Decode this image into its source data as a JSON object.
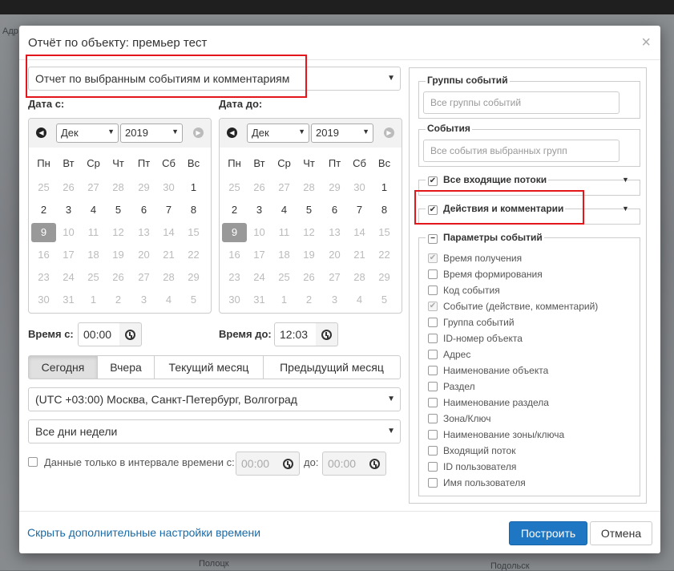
{
  "modal": {
    "title": "Отчёт по объекту: премьер  тест",
    "close": "×"
  },
  "report_type": {
    "selected": "Отчет по выбранным событиям и комментариям"
  },
  "date_from": {
    "label": "Дата с:",
    "month": "Дек",
    "year": "2019",
    "weekdays": [
      "Пн",
      "Вт",
      "Ср",
      "Чт",
      "Пт",
      "Сб",
      "Вс"
    ],
    "weeks": [
      [
        "25",
        "26",
        "27",
        "28",
        "29",
        "30",
        "1"
      ],
      [
        "2",
        "3",
        "4",
        "5",
        "6",
        "7",
        "8"
      ],
      [
        "9",
        "10",
        "11",
        "12",
        "13",
        "14",
        "15"
      ],
      [
        "16",
        "17",
        "18",
        "19",
        "20",
        "21",
        "22"
      ],
      [
        "23",
        "24",
        "25",
        "26",
        "27",
        "28",
        "29"
      ],
      [
        "30",
        "31",
        "1",
        "2",
        "3",
        "4",
        "5"
      ]
    ],
    "time_label": "Время с:",
    "time": "00:00"
  },
  "date_to": {
    "label": "Дата до:",
    "month": "Дек",
    "year": "2019",
    "time_label": "Время до:",
    "time": "12:03"
  },
  "quick": [
    "Сегодня",
    "Вчера",
    "Текущий месяц",
    "Предыдущий месяц"
  ],
  "timezone": "(UTC +03:00) Москва, Санкт-Петербург, Волгоград",
  "weekdays_select": "Все дни недели",
  "interval": {
    "label": "Данные только в интервале времени с:",
    "from_placeholder": "00:00",
    "to_label": "до:",
    "to_placeholder": "00:00"
  },
  "right": {
    "groups_title": "Группы событий",
    "groups_placeholder": "Все группы событий",
    "events_title": "События",
    "events_placeholder": "Все события выбранных групп",
    "streams_title": "Все входящие потоки",
    "actions_title": "Действия и комментарии",
    "params_title": "Параметры событий",
    "params": [
      {
        "label": "Время получения",
        "checked": true,
        "disabled": true
      },
      {
        "label": "Время формирования",
        "checked": false,
        "disabled": false
      },
      {
        "label": "Код события",
        "checked": false,
        "disabled": false
      },
      {
        "label": "Событие (действие, комментарий)",
        "checked": true,
        "disabled": true
      },
      {
        "label": "Группа событий",
        "checked": false,
        "disabled": false
      },
      {
        "label": "ID-номер объекта",
        "checked": false,
        "disabled": false
      },
      {
        "label": "Адрес",
        "checked": false,
        "disabled": false
      },
      {
        "label": "Наименование объекта",
        "checked": false,
        "disabled": false
      },
      {
        "label": "Раздел",
        "checked": false,
        "disabled": false
      },
      {
        "label": "Наименование раздела",
        "checked": false,
        "disabled": false
      },
      {
        "label": "Зона/Ключ",
        "checked": false,
        "disabled": false
      },
      {
        "label": "Наименование зоны/ключа",
        "checked": false,
        "disabled": false
      },
      {
        "label": "Входящий поток",
        "checked": false,
        "disabled": false
      },
      {
        "label": "ID пользователя",
        "checked": false,
        "disabled": false
      },
      {
        "label": "Имя пользователя",
        "checked": false,
        "disabled": false
      }
    ]
  },
  "footer": {
    "link": "Скрыть дополнительные настройки времени",
    "build": "Построить",
    "cancel": "Отмена"
  },
  "background": {
    "left_text": "Адр",
    "bottom_text_1": "Полоцк",
    "bottom_text_2": "Подольск"
  }
}
